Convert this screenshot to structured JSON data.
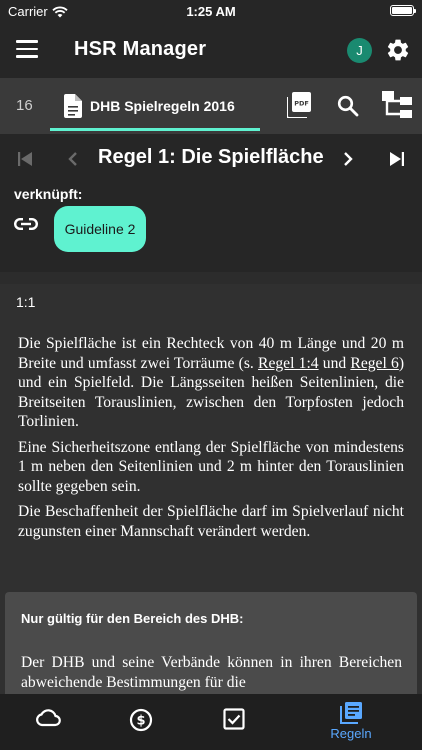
{
  "status_bar": {
    "carrier": "Carrier",
    "time": "1:25 AM"
  },
  "app_bar": {
    "title": "HSR Manager",
    "avatar_initial": "J"
  },
  "tab_bar": {
    "tab_count": "16",
    "document_title": "DHB Spielregeln 2016",
    "icons": [
      "pdf-icon",
      "search-icon",
      "tree-icon"
    ]
  },
  "nav": {
    "rule_title": "Regel 1: Die Spielfläche"
  },
  "linked": {
    "heading": "verknüpft:",
    "chips": [
      {
        "label": "Guideline 2"
      }
    ]
  },
  "content": {
    "section_number": "1:1",
    "paragraph1": {
      "part1": "Die Spielfläche ist ein Rechteck von 40 m Länge und 20 m Breite und umfasst zwei Torräume (s. ",
      "link1": "Regel 1:4",
      "part2": " und ",
      "link2": "Regel 6",
      "part3": ") und ein Spielfeld. Die Längsseiten heißen Seitenlinien, die Breitseiten Toraus­linien, zwischen den Torpfosten jedoch Torlinien."
    },
    "paragraph2": "Eine Sicherheitszone entlang der Spielfläche von mindestens 1 m  neben den Seitenlinien und 2 m hinter den Torauslinien sollte gegeben  sein.",
    "paragraph3": "Die Beschaffenheit der Spielfläche darf im Spielverlauf nicht zugunsten einer Mannschaft verändert werden.",
    "note": {
      "heading": "Nur gültig für den Bereich des DHB:",
      "body": "Der DHB und seine Verbände können in ihren Bereichen abweichende Bestimmungen für die"
    }
  },
  "bottom_nav": {
    "items": [
      {
        "icon": "cloud-icon",
        "label": ""
      },
      {
        "icon": "dollar-icon",
        "label": ""
      },
      {
        "icon": "checkbox-icon",
        "label": ""
      },
      {
        "icon": "rules-icon",
        "label": "Regeln"
      }
    ],
    "active_color": "#5aa8ff"
  },
  "colors": {
    "accent": "#5ff2d0",
    "avatar": "#1a8a70"
  }
}
